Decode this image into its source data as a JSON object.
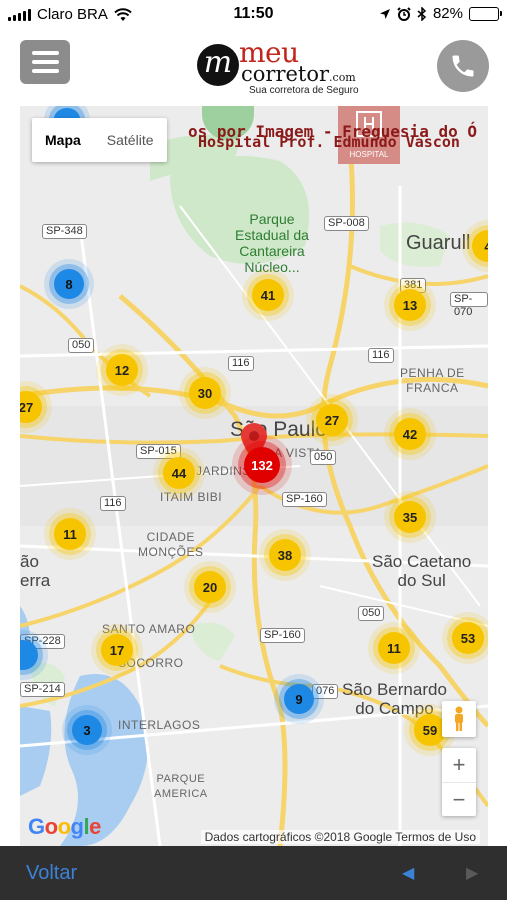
{
  "status_bar": {
    "carrier": "Claro BRA",
    "time": "11:50",
    "battery": "82%",
    "battery_level": 0.82
  },
  "header": {
    "logo_mark": "m",
    "logo_meu": "meu",
    "logo_corretor": "corretor",
    "logo_com": ".com",
    "logo_tagline": "Sua corretora de Seguro"
  },
  "map": {
    "map_type": {
      "map_label": "Mapa",
      "satellite_label": "Satélite"
    },
    "overlay_text_1": "os por Imagem - Freguesia do Ó",
    "overlay_text_2": "Hospital Prof. Edmundo Vascon",
    "hospital_label": "HOSPITAL",
    "places": {
      "parque": "Parque\nEstadual da\nCantareira\nNúcleo...",
      "guarulhos": "Guarull",
      "penha": "PENHA DE\nFRANCA",
      "sao_paulo": "São Paulo",
      "bela_vista": "BELA VISTA",
      "jardins": "JARDINS",
      "itaim": "ITAIM BIBI",
      "cidade_moncoes": "CIDADE\nMONÇÕES",
      "sao_caetano": "São Caetano\ndo Sul",
      "santo_amaro": "SANTO AMARO",
      "socorro": "SOCORRO",
      "interlagos": "INTERLAGOS",
      "parque_america": "PARQUE\nAMERICA",
      "sao_bernardo": "São Bernardo\ndo Campo",
      "sao_joao": "ão\nerra"
    },
    "shields": {
      "sp348": "SP-348",
      "sp008": "SP-008",
      "r381": "381",
      "sp070": "SP-070",
      "r050a": "050",
      "r116a": "116",
      "r116b": "116",
      "sp015": "SP-015",
      "r050b": "050",
      "sp160a": "SP-160",
      "r116c": "116",
      "r050c": "050",
      "sp160b": "SP-160",
      "sp228": "SP-228",
      "sp214": "SP-214",
      "r076": "076"
    },
    "clusters": {
      "c8": "8",
      "c41": "41",
      "c13": "13",
      "c4": "4",
      "c12": "12",
      "c30": "30",
      "c27a": "27",
      "c27b": "27",
      "c42": "42",
      "c132": "132",
      "c44": "44",
      "c35": "35",
      "c11a": "11",
      "c38": "38",
      "c20": "20",
      "c53": "53",
      "c17": "17",
      "c11b": "11",
      "c9": "9",
      "c3": "3",
      "c59": "59"
    },
    "zoom_in": "+",
    "zoom_out": "−",
    "google_logo": "Google",
    "attribution": "Dados cartográficos ©2018 Google   Termos de Uso"
  },
  "bottom_bar": {
    "back_label": "Voltar",
    "prev_arrow": "◀",
    "next_arrow": "▶"
  },
  "colors": {
    "cluster_yellow": "#f7c500",
    "cluster_blue": "#1e88e5",
    "cluster_red": "#e00000",
    "link_blue": "#3b82d6",
    "logo_red": "#c0261c"
  }
}
